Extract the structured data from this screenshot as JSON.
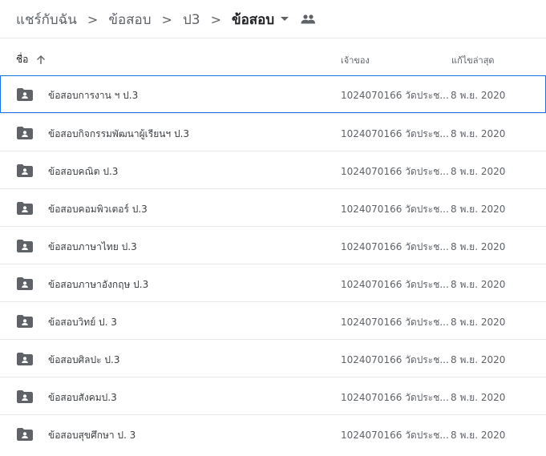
{
  "breadcrumb": {
    "items": [
      "แชร์กับฉัน",
      "ข้อสอบ",
      "ป3"
    ],
    "current": "ข้อสอบ",
    "separator": ">",
    "dropdown_icon": "chevron-down-icon",
    "shared_icon": "people-icon"
  },
  "header": {
    "name": "ชื่อ",
    "owner": "เจ้าของ",
    "modified": "แก้ไขล่าสุด",
    "sort_icon": "arrow-up-icon"
  },
  "colors": {
    "folder": "#5f6368",
    "selection": "#1a73e8",
    "divider": "#e8eaed"
  },
  "rows": [
    {
      "name": "ข้อสอบการงาน ฯ ป.3",
      "owner": "1024070166 วัดประช...",
      "modified": "8 พ.ย. 2020"
    },
    {
      "name": "ข้อสอบกิจกรรมพัฒนาผู้เรียนฯ ป.3",
      "owner": "1024070166 วัดประช...",
      "modified": "8 พ.ย. 2020"
    },
    {
      "name": "ข้อสอบคณิต ป.3",
      "owner": "1024070166 วัดประช...",
      "modified": "8 พ.ย. 2020"
    },
    {
      "name": "ข้อสอบคอมพิวเตอร์ ป.3",
      "owner": "1024070166 วัดประช...",
      "modified": "8 พ.ย. 2020"
    },
    {
      "name": "ข้อสอบภาษาไทย  ป.3",
      "owner": "1024070166 วัดประช...",
      "modified": "8 พ.ย. 2020"
    },
    {
      "name": "ข้อสอบภาษาอังกฤษ ป.3",
      "owner": "1024070166 วัดประช...",
      "modified": "8 พ.ย. 2020"
    },
    {
      "name": "ข้อสอบวิทย์ ป. 3",
      "owner": "1024070166 วัดประช...",
      "modified": "8 พ.ย. 2020"
    },
    {
      "name": "ข้อสอบศิลปะ ป.3",
      "owner": "1024070166 วัดประช...",
      "modified": "8 พ.ย. 2020"
    },
    {
      "name": "ข้อสอบสังคมป.3",
      "owner": "1024070166 วัดประช...",
      "modified": "8 พ.ย. 2020"
    },
    {
      "name": "ข้อสอบสุขศึกษา ป. 3",
      "owner": "1024070166 วัดประช...",
      "modified": "8 พ.ย. 2020"
    }
  ]
}
